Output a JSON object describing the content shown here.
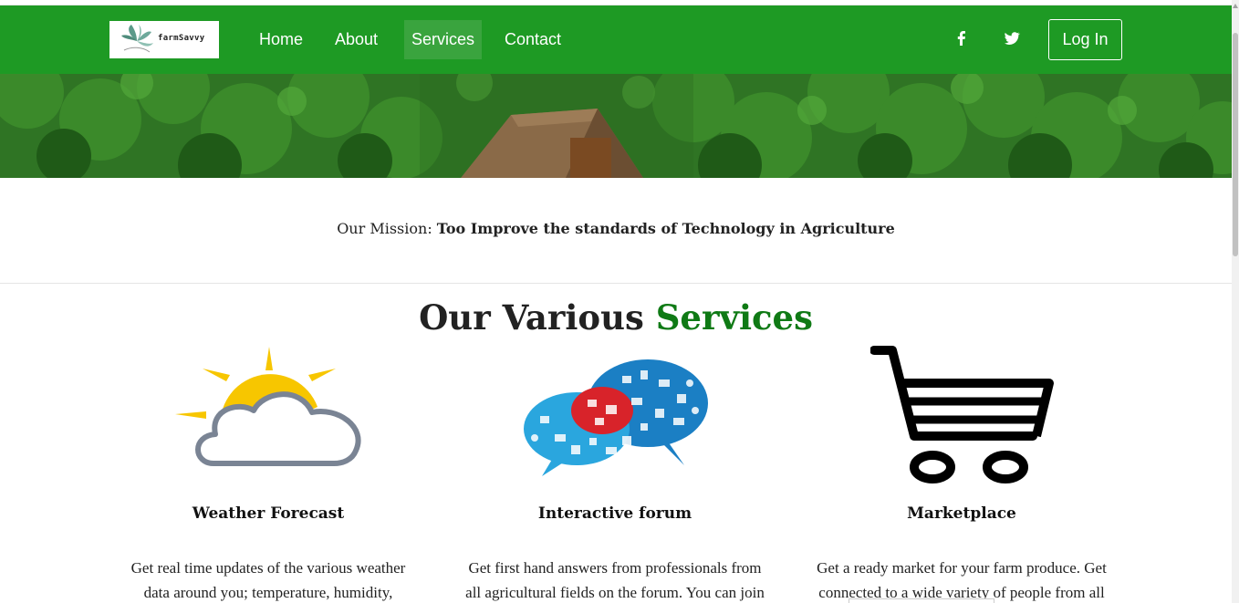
{
  "navbar": {
    "logo_text": "farmSavvy",
    "links": [
      {
        "label": "Home"
      },
      {
        "label": "About"
      },
      {
        "label": "Services",
        "active": true
      },
      {
        "label": "Contact"
      }
    ],
    "login_label": "Log In",
    "social_icons": [
      "facebook-icon",
      "twitter-icon"
    ],
    "bg_color": "#1e9a24"
  },
  "mission": {
    "prefix": "Our Mission: ",
    "text": "Too Improve the standards of Technology in Agriculture"
  },
  "services": {
    "heading_part1": "Our Various ",
    "heading_part2": "Services",
    "accent_color": "#0f7a15",
    "items": [
      {
        "icon": "weather-icon",
        "title": "Weather Forecast",
        "desc_line1": "Get real time updates of the various weather",
        "desc_line2": "data around you; temperature, humidity,"
      },
      {
        "icon": "forum-icon",
        "title": "Interactive forum",
        "desc_line1": "Get first hand answers from professionals from",
        "desc_line2": "all agricultural fields on the forum. You can join"
      },
      {
        "icon": "cart-icon",
        "title": "Marketplace",
        "desc_line1": "Get a ready market for your farm produce. Get",
        "desc_line2": "connected to a wide variety of people from all"
      }
    ]
  }
}
